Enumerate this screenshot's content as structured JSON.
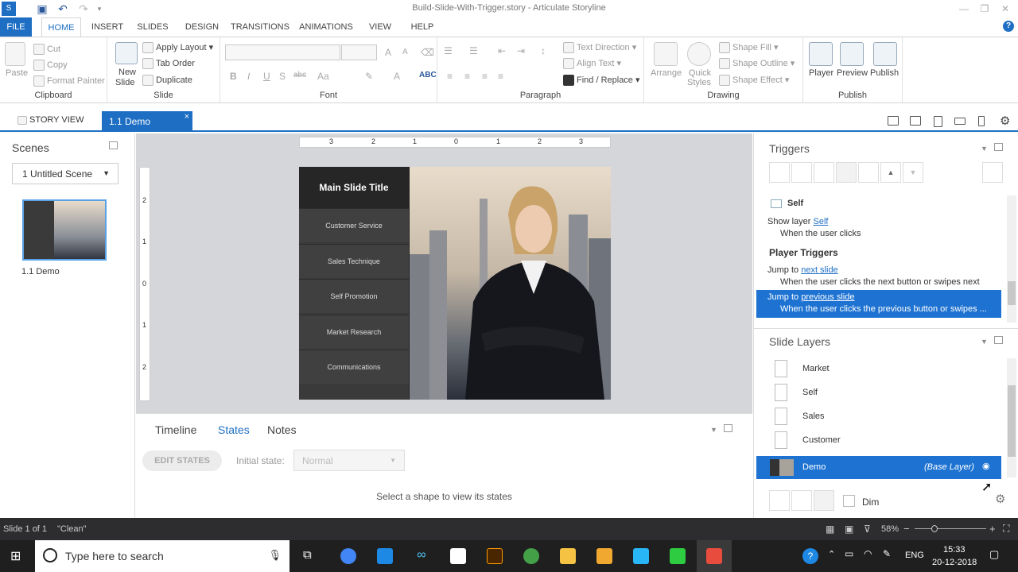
{
  "window": {
    "title": "Build-Slide-With-Trigger.story - Articulate Storyline"
  },
  "ribbon_tabs": [
    "FILE",
    "HOME",
    "INSERT",
    "SLIDES",
    "DESIGN",
    "TRANSITIONS",
    "ANIMATIONS",
    "VIEW",
    "HELP"
  ],
  "help_label": "?",
  "clipboard": {
    "paste": "Paste",
    "cut": "Cut",
    "copy": "Copy",
    "format_painter": "Format Painter",
    "label": "Clipboard"
  },
  "slide_group": {
    "new_slide": "New",
    "new_slide2": "Slide",
    "apply_layout": "Apply Layout",
    "tab_order": "Tab Order",
    "duplicate": "Duplicate",
    "label": "Slide"
  },
  "font_group": {
    "label": "Font",
    "bold": "B",
    "italic": "I",
    "underline": "U",
    "shadow": "S",
    "strike": "abc",
    "size_up": "A",
    "size_down": "A",
    "case": "Aa",
    "font_color": "A"
  },
  "paragraph_group": {
    "label": "Paragraph",
    "text_direction": "Text Direction",
    "align_text": "Align Text",
    "find_replace": "Find / Replace"
  },
  "drawing_group": {
    "label": "Drawing",
    "arrange": "Arrange",
    "quick_styles": "Quick",
    "quick_styles2": "Styles",
    "shape_fill": "Shape Fill",
    "shape_outline": "Shape Outline",
    "shape_effect": "Shape Effect"
  },
  "publish_group": {
    "label": "Publish",
    "player": "Player",
    "preview": "Preview",
    "publish": "Publish"
  },
  "viewbar": {
    "story_view": "STORY VIEW",
    "slide_tab": "1.1 Demo",
    "close": "×"
  },
  "scenes": {
    "header": "Scenes",
    "selected_scene": "1 Untitled Scene",
    "thumb_caption": "1.1 Demo"
  },
  "ruler": {
    "h_ticks": [
      "3",
      "2",
      "1",
      "0",
      "1",
      "2",
      "3"
    ],
    "v_ticks": [
      "2",
      "1",
      "0",
      "1",
      "2"
    ]
  },
  "slide": {
    "title": "Main Slide Title",
    "menu": [
      "Customer Service",
      "Sales Technique",
      "Self Promotion",
      "Market Research",
      "Communications"
    ]
  },
  "bottom_pane": {
    "tabs": [
      "Timeline",
      "States",
      "Notes"
    ],
    "active": "States",
    "edit_states": "EDIT STATES",
    "initial_state_label": "Initial state:",
    "initial_state_value": "Normal",
    "message": "Select a shape to view its states"
  },
  "triggers": {
    "header": "Triggers",
    "self_label": "Self",
    "t1_action": "Show layer",
    "t1_target": "Self",
    "t1_condition": "When the user clicks",
    "player_triggers": "Player Triggers",
    "t2_action": "Jump to",
    "t2_target": "next slide",
    "t2_condition": "When the user clicks the next button or swipes next",
    "t3_action": "Jump to",
    "t3_target": "previous slide",
    "t3_condition": "When the user clicks the previous button or swipes ..."
  },
  "slide_layers": {
    "header": "Slide Layers",
    "layers": [
      "Market",
      "Self",
      "Sales",
      "Customer"
    ],
    "base_name": "Demo",
    "base_tag": "(Base Layer)",
    "dim": "Dim"
  },
  "status": {
    "slide": "Slide 1 of 1",
    "theme": "\"Clean\"",
    "zoom": "58%"
  },
  "taskbar": {
    "search_placeholder": "Type here to search",
    "lang": "ENG",
    "time": "15:33",
    "date": "20-12-2018"
  },
  "colors": {
    "accent": "#1e6fc4",
    "selection": "#1e73d2",
    "status_bg": "#2d2d30"
  }
}
